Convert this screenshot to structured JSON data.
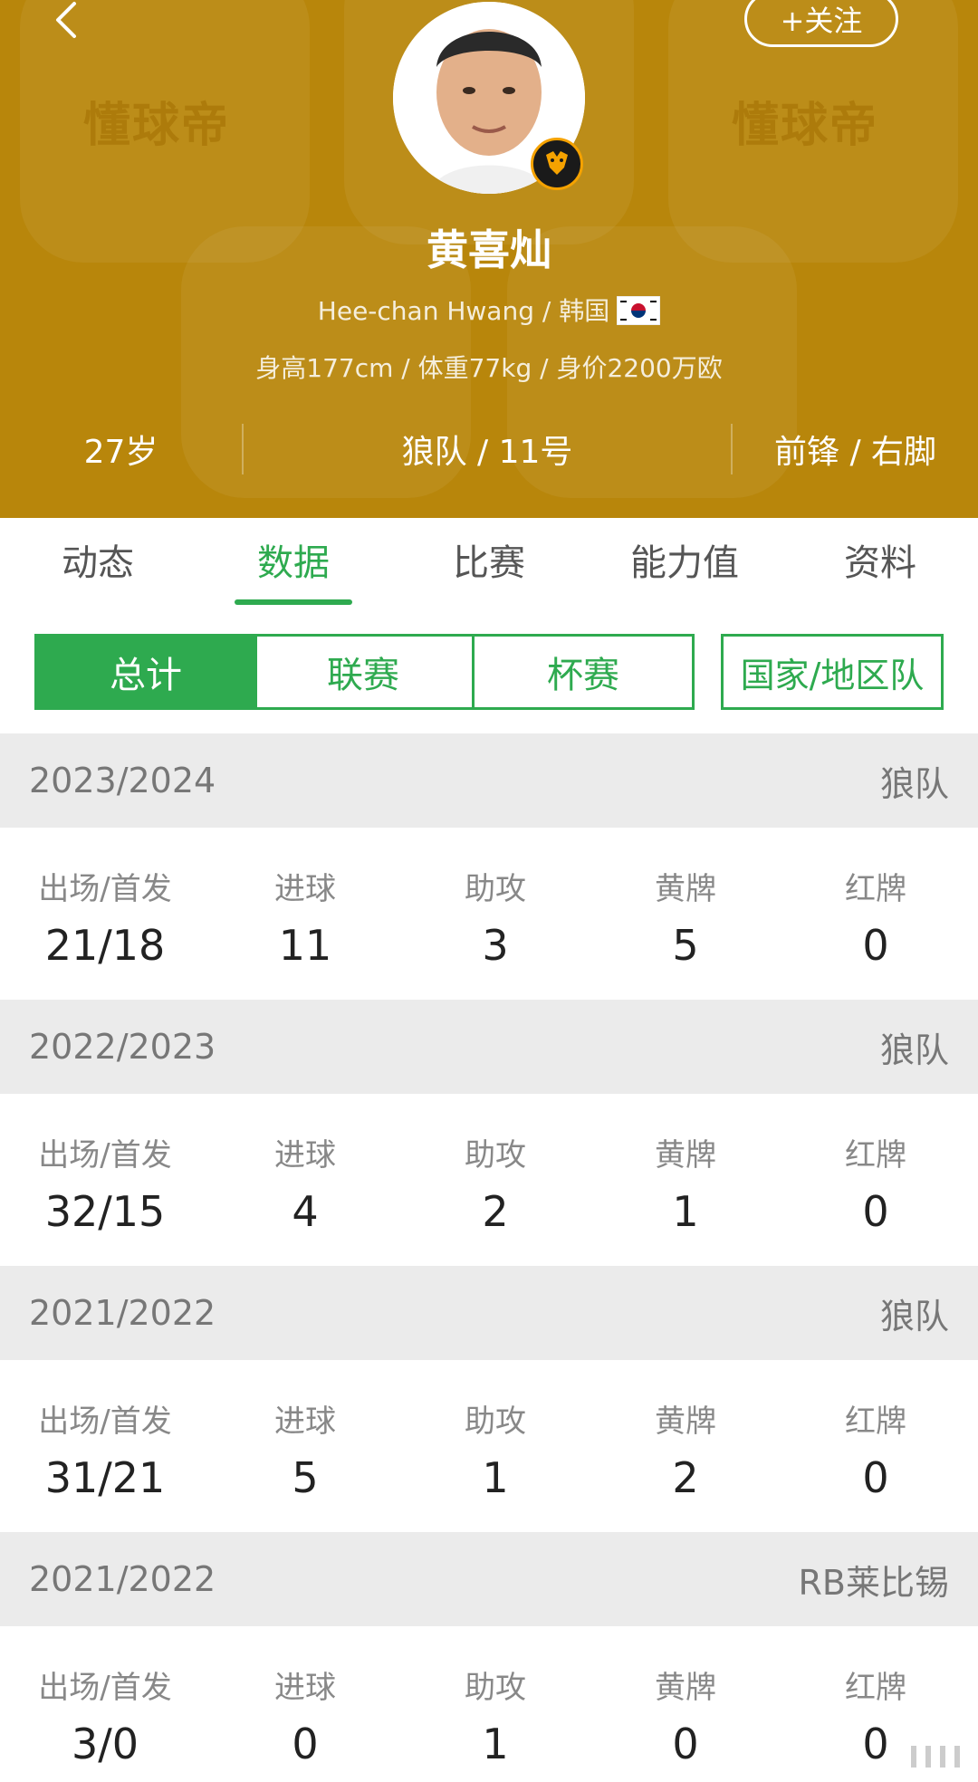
{
  "header": {
    "watermark": "懂球帝",
    "follow_label": "+关注",
    "player_name": "黄喜灿",
    "name_country": "Hee-chan Hwang / 韩国",
    "physical": "身高177cm / 体重77kg / 身价2200万欧",
    "age": "27岁",
    "team_number": "狼队 / 11号",
    "position_foot": "前锋 / 右脚",
    "brand_color": "#b8860b"
  },
  "tabs": [
    {
      "label": "动态"
    },
    {
      "label": "数据"
    },
    {
      "label": "比赛"
    },
    {
      "label": "能力值"
    },
    {
      "label": "资料"
    }
  ],
  "active_tab": "数据",
  "filters": [
    {
      "label": "总计"
    },
    {
      "label": "联赛"
    },
    {
      "label": "杯赛"
    },
    {
      "label": "国家/地区队"
    }
  ],
  "active_filter": "总计",
  "accent_color": "#2eaa4f",
  "stat_labels": [
    "出场/首发",
    "进球",
    "助攻",
    "黄牌",
    "红牌"
  ],
  "seasons": [
    {
      "season": "2023/2024",
      "team": "狼队",
      "values": [
        "21/18",
        "11",
        "3",
        "5",
        "0"
      ]
    },
    {
      "season": "2022/2023",
      "team": "狼队",
      "values": [
        "32/15",
        "4",
        "2",
        "1",
        "0"
      ]
    },
    {
      "season": "2021/2022",
      "team": "狼队",
      "values": [
        "31/21",
        "5",
        "1",
        "2",
        "0"
      ]
    },
    {
      "season": "2021/2022",
      "team": "RB莱比锡",
      "values": [
        "3/0",
        "0",
        "1",
        "0",
        "0"
      ]
    }
  ],
  "icons": {
    "back": "chevron-left-icon",
    "club_badge": "wolves-badge-icon",
    "flag": "korea-flag-icon",
    "more": "more-dots-icon"
  }
}
